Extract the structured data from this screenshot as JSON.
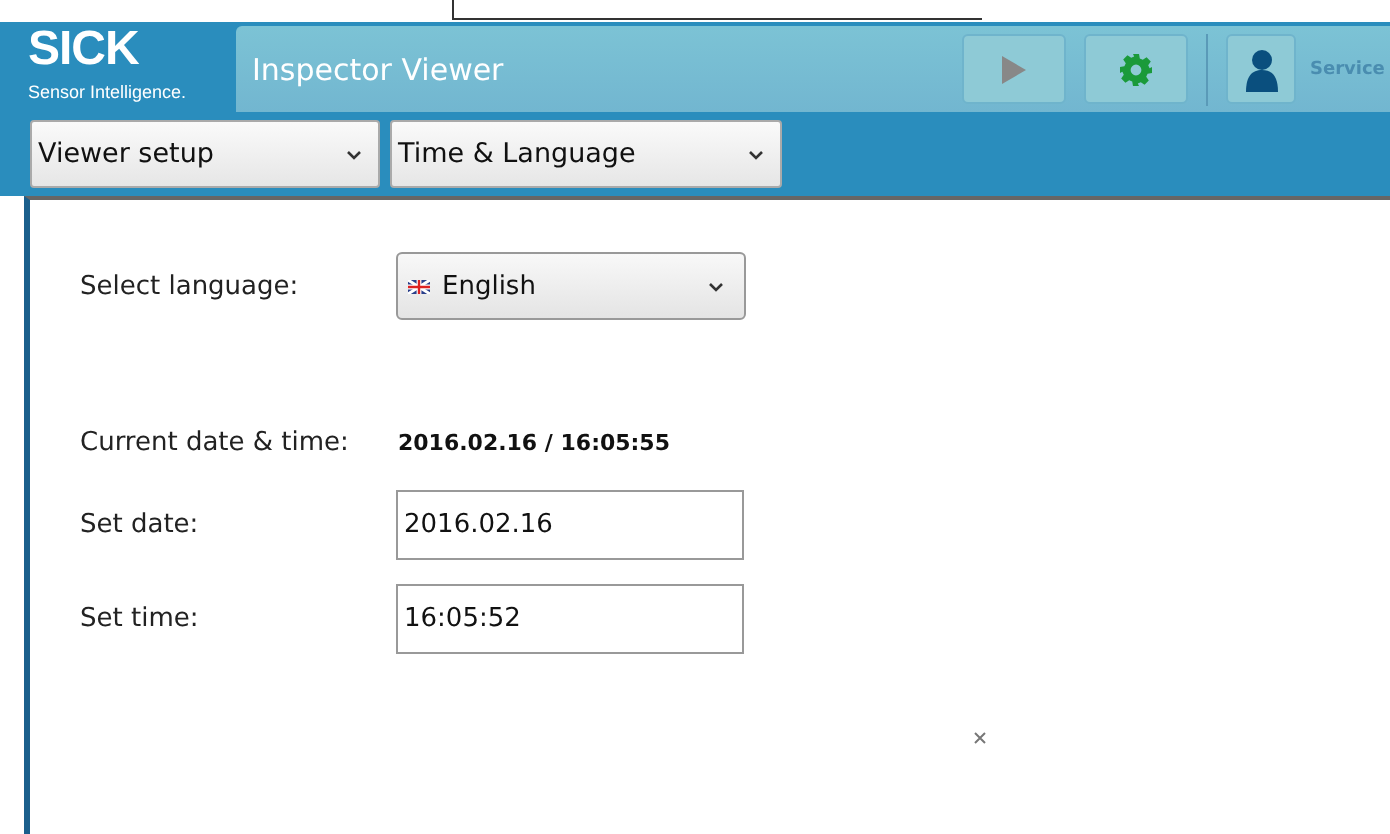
{
  "header": {
    "logo": "SICK",
    "tagline": "Sensor Intelligence.",
    "title": "Inspector Viewer",
    "user_label": "Service"
  },
  "menus": [
    {
      "label": "Viewer setup"
    },
    {
      "label": "Time & Language"
    }
  ],
  "language": {
    "label": "Select language:",
    "value": "English"
  },
  "current": {
    "label": "Current date & time:",
    "value": "2016.02.16 / 16:05:55"
  },
  "fields": [
    {
      "label": "Set date:",
      "value": "2016.02.16"
    },
    {
      "label": "Set time:",
      "value": "16:05:52"
    }
  ]
}
